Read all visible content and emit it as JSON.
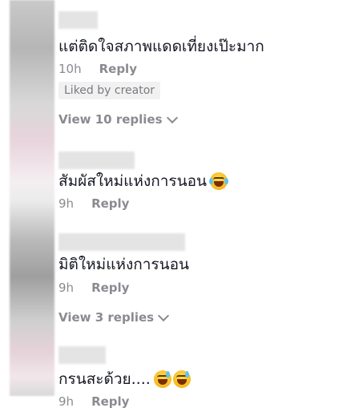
{
  "comments": [
    {
      "text": "แต่ติดใจสภาพแดดเที่ยงเป๊ะมาก",
      "time": "10h",
      "reply_label": "Reply",
      "badge": "Liked by creator",
      "view_replies": "View 10 replies"
    },
    {
      "text": "สัมผัสใหม่แห่งการนอน",
      "emoji": "face-with-tears-of-joy",
      "time": "9h",
      "reply_label": "Reply"
    },
    {
      "text": "มิติใหม่แห่งการนอน",
      "time": "9h",
      "reply_label": "Reply",
      "view_replies": "View 3 replies"
    },
    {
      "text": "กรนสะด้วย....",
      "emoji": "grinning-face-with-sweat",
      "time": "9h",
      "reply_label": "Reply"
    }
  ],
  "colors": {
    "text": "#161823",
    "secondary": "#8a8b91",
    "badge_bg": "#f1f1f2"
  }
}
